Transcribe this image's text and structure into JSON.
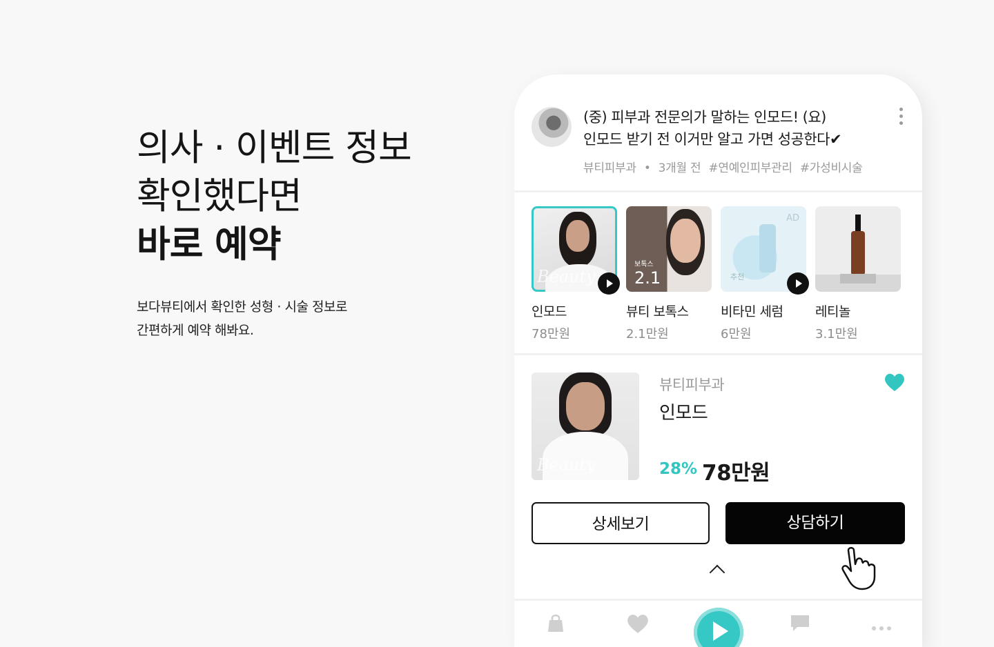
{
  "hero": {
    "line1": "의사 · 이벤트 정보",
    "line2": "확인했다면",
    "line3": "바로 예약",
    "sub1": "보다뷰티에서 확인한 성형 · 시술 정보로",
    "sub2": "간편하게 예약 해봐요."
  },
  "post": {
    "title1": "(중) 피부과 전문의가 말하는 인모드! (요)",
    "title2": "인모드 받기 전 이거만 알고 가면 성공한다✔",
    "meta": [
      "뷰티피부과",
      "•",
      "3개월 전",
      "#연예인피부관리",
      "#가성비시술"
    ]
  },
  "cards": [
    {
      "name": "인모드",
      "price": "78만원",
      "overlay": "Beauty"
    },
    {
      "name": "뷰티 보톡스",
      "price": "2.1만원",
      "tag": "보톡스",
      "num": "2.1"
    },
    {
      "name": "비타민 세럼",
      "price": "6만원",
      "badge": "AD",
      "rec": "추천"
    },
    {
      "name": "레티놀",
      "price": "3.1만원"
    }
  ],
  "detail": {
    "clinic": "뷰티피부과",
    "name": "인모드",
    "discount": "28%",
    "price": "78만원",
    "overlay": "Beauty",
    "detail_label": "상세보기",
    "consult_label": "상담하기"
  },
  "colors": {
    "accent": "#35c8c4",
    "dark": "#050505",
    "muted": "#9a9a9a"
  },
  "icons": [
    "more-vertical-icon",
    "play-icon",
    "heart-icon",
    "chevron-up-icon",
    "hand-pointer-icon",
    "bag-icon",
    "chat-icon",
    "home-play-icon"
  ]
}
